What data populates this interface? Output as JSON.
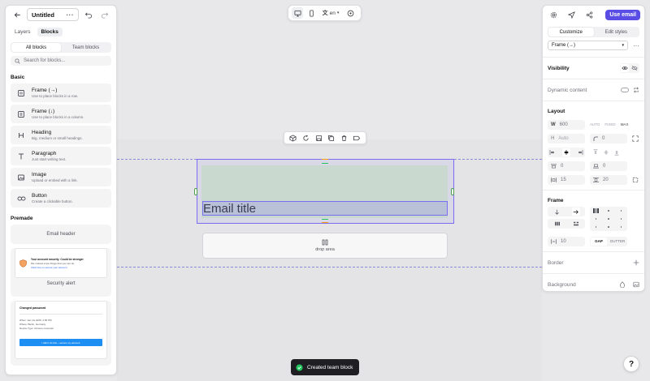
{
  "left_panel": {
    "doc_title": "Untitled",
    "tabs": [
      "Layers",
      "Blocks"
    ],
    "segments": [
      "All blocks",
      "Team blocks"
    ],
    "search_placeholder": "Search for blocks...",
    "basic_title": "Basic",
    "blocks": [
      {
        "title": "Frame (→)",
        "desc": "Use to place blocks in a row.",
        "icon": "frame-row-icon"
      },
      {
        "title": "Frame (↓)",
        "desc": "Use to place blocks in a column.",
        "icon": "frame-column-icon"
      },
      {
        "title": "Heading",
        "desc": "Big, medium or small headings.",
        "icon": "heading-icon"
      },
      {
        "title": "Paragraph",
        "desc": "Just start writing text.",
        "icon": "paragraph-icon"
      },
      {
        "title": "Image",
        "desc": "Upload or embed with a link.",
        "icon": "image-icon"
      },
      {
        "title": "Button",
        "desc": "Create a clickable button.",
        "icon": "link-icon"
      }
    ],
    "premade_title": "Premade",
    "premade": [
      {
        "label": "Email header"
      },
      {
        "label": "Security alert",
        "card_title": "Your account security: Could be stronger",
        "card_text": "We noticed a few things that you can do.",
        "card_link": "Click here to secure your account"
      },
      {
        "label": "",
        "card_title": "Changed password",
        "card_lines": [
          "When: Jan 1st 2025, 2:00 PM",
          "Where: Berlin, Germany",
          "Device Type: Chrome computer"
        ],
        "card_button": "I didn't do this – secure my account"
      }
    ]
  },
  "top_toolbar": {
    "language": "en"
  },
  "canvas": {
    "email_title": "Email title",
    "drop_area_label": "drop area"
  },
  "right_panel": {
    "use_email_label": "Use email",
    "segments": [
      "Customize",
      "Edit styles"
    ],
    "frame_select": "Frame (→)",
    "visibility_label": "Visibility",
    "dynamic_label": "Dynamic content",
    "layout": {
      "title": "Layout",
      "width_label": "W",
      "width_value": "600",
      "width_modes": [
        "AUTO",
        "FIXED",
        "MAX"
      ],
      "height_label": "H",
      "height_value": "Auto",
      "radius_value": "0",
      "padding_top": "0",
      "padding_right": "0",
      "padding_x": "15",
      "padding_y": "20"
    },
    "frame": {
      "title": "Frame",
      "gap_value": "10",
      "gap_modes": [
        "GAP",
        "GUTTER"
      ]
    },
    "border_label": "Border",
    "background_label": "Background"
  },
  "toast": {
    "message": "Created team block"
  },
  "help_label": "?",
  "colors": {
    "accent": "#5a4de6",
    "selection": "#7b6df2",
    "padding_green": "#a0dc8c",
    "toast_check": "#22c55e"
  }
}
